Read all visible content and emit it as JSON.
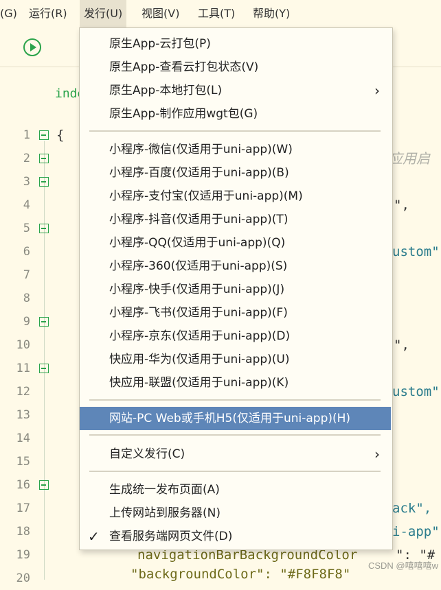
{
  "menubar": {
    "items": [
      {
        "text": "(G)",
        "mnemonic": "G",
        "prefix": "("
      },
      {
        "text": "运行(R)"
      },
      {
        "text": "发行(U)"
      },
      {
        "text": "视图(V)"
      },
      {
        "text": "工具(T)"
      },
      {
        "text": "帮助(Y)"
      }
    ]
  },
  "toolbar": {
    "run_icon": "play-circle-icon"
  },
  "editor": {
    "tab_fragment": "inde",
    "line_numbers": [
      "1",
      "2",
      "3",
      "4",
      "5",
      "6",
      "7",
      "8",
      "9",
      "10",
      "11",
      "12",
      "13",
      "14",
      "15",
      "16",
      "17",
      "18",
      "19",
      "20"
    ],
    "code": {
      "l1": "{",
      "l2_comment": "应用启",
      "l4": "\",",
      "l6": "ustom\"",
      "l10": "\",",
      "l12": "ustom\"",
      "l17": "ack\",",
      "l18": "i-app\"",
      "l19a": "navigationBarBackgroundColor",
      "l19b": "\": \"#",
      "l20": "\"backgroundColor\": \"#F8F8F8\""
    }
  },
  "dropdown": {
    "items": [
      "原生App-云打包(P)",
      "原生App-查看云打包状态(V)",
      "原生App-本地打包(L)",
      "原生App-制作应用wgt包(G)",
      "小程序-微信(仅适用于uni-app)(W)",
      "小程序-百度(仅适用于uni-app)(B)",
      "小程序-支付宝(仅适用于uni-app)(M)",
      "小程序-抖音(仅适用于uni-app)(T)",
      "小程序-QQ(仅适用于uni-app)(Q)",
      "小程序-360(仅适用于uni-app)(S)",
      "小程序-快手(仅适用于uni-app)(J)",
      "小程序-飞书(仅适用于uni-app)(F)",
      "小程序-京东(仅适用于uni-app)(D)",
      "快应用-华为(仅适用于uni-app)(U)",
      "快应用-联盟(仅适用于uni-app)(K)",
      "网站-PC Web或手机H5(仅适用于uni-app)(H)",
      "自定义发行(C)",
      "生成统一发布页面(A)",
      "上传网站到服务器(N)",
      "查看服务端网页文件(D)"
    ],
    "highlight_color": "#5e86b8"
  },
  "watermark": "CSDN @嘻嘻嘻w"
}
